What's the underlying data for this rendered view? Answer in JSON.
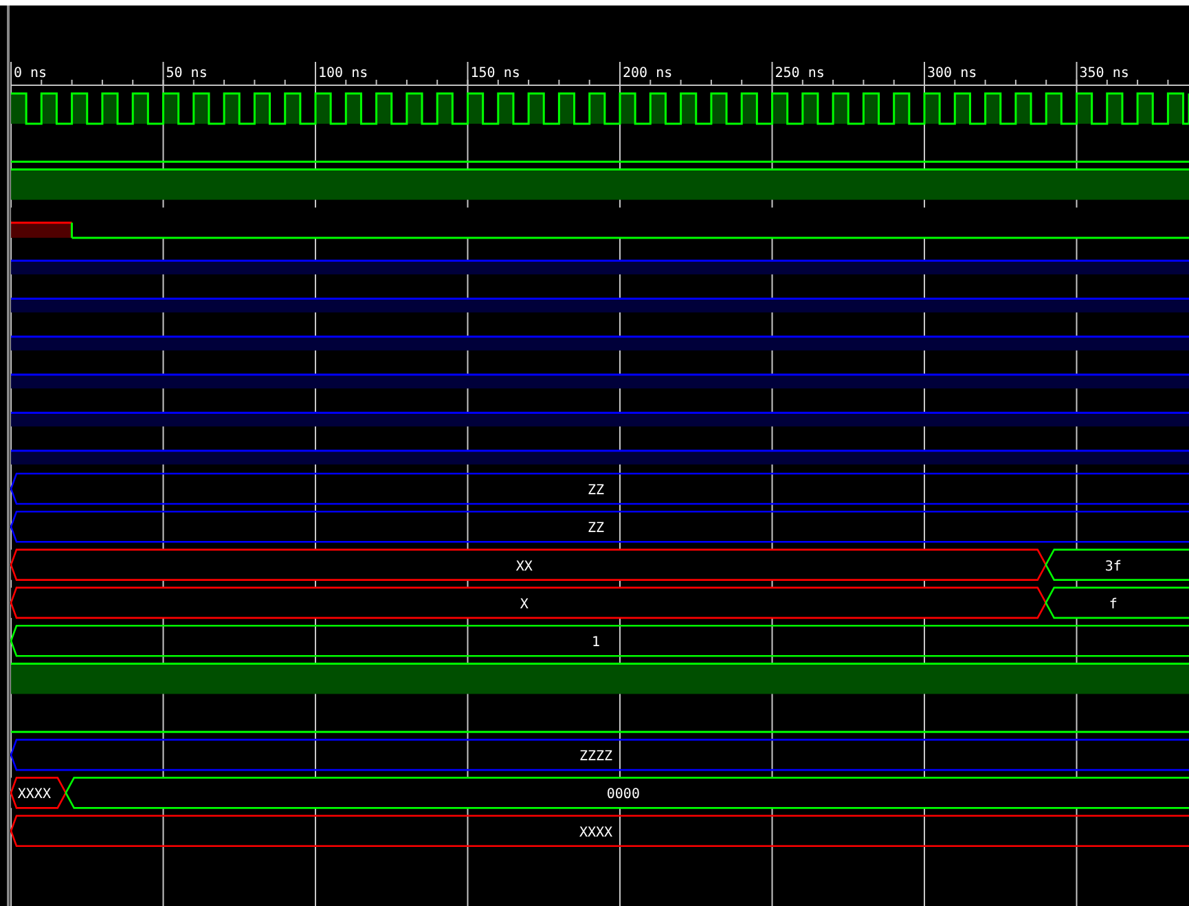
{
  "ruler": {
    "labels": [
      "0 ns",
      "50 ns",
      "100 ns",
      "150 ns",
      "200 ns",
      "250 ns",
      "300 ns",
      "350 ns"
    ]
  },
  "signals": [
    {
      "kind": "clock"
    },
    {
      "kind": "bit",
      "segments": [
        {
          "kind": "low"
        }
      ]
    },
    {
      "kind": "bit",
      "segments": [
        {
          "kind": "high"
        }
      ]
    },
    {
      "kind": "bit",
      "segments": [
        {
          "kind": "unknown",
          "level": 0.0515
        },
        {
          "kind": "low"
        }
      ]
    },
    {
      "kind": "bit",
      "segments": [
        {
          "kind": "tristate"
        }
      ]
    },
    {
      "kind": "bit",
      "segments": [
        {
          "kind": "tristate"
        }
      ]
    },
    {
      "kind": "bit",
      "segments": [
        {
          "kind": "tristate"
        }
      ]
    },
    {
      "kind": "bit",
      "segments": [
        {
          "kind": "tristate"
        }
      ]
    },
    {
      "kind": "bit",
      "segments": [
        {
          "kind": "tristate"
        }
      ]
    },
    {
      "kind": "bit",
      "segments": [
        {
          "kind": "tristate"
        }
      ]
    },
    {
      "kind": "bus",
      "segments": [
        {
          "kind": "tristate",
          "label": "ZZ"
        }
      ]
    },
    {
      "kind": "bus",
      "segments": [
        {
          "kind": "tristate",
          "label": "ZZ"
        }
      ]
    },
    {
      "kind": "bus",
      "segments": [
        {
          "kind": "unknown",
          "label": "XX",
          "level": 0.876
        },
        {
          "kind": "valid",
          "label": "3f"
        }
      ]
    },
    {
      "kind": "bus",
      "segments": [
        {
          "kind": "unknown",
          "label": "X",
          "level": 0.876
        },
        {
          "kind": "valid",
          "label": "f"
        }
      ]
    },
    {
      "kind": "bus",
      "segments": [
        {
          "kind": "valid",
          "label": "1"
        }
      ]
    },
    {
      "kind": "bit",
      "segments": [
        {
          "kind": "high"
        }
      ]
    },
    {
      "kind": "bit",
      "segments": [
        {
          "kind": "low"
        }
      ]
    },
    {
      "kind": "bus",
      "segments": [
        {
          "kind": "tristate",
          "label": "ZZZZ"
        }
      ]
    },
    {
      "kind": "bus",
      "segments": [
        {
          "kind": "unknown",
          "label": "XXXX",
          "level": 0.0464
        },
        {
          "kind": "valid",
          "label": "0000"
        }
      ]
    },
    {
      "kind": "bus",
      "segments": [
        {
          "kind": "unknown",
          "label": "XXXX"
        }
      ]
    }
  ]
}
